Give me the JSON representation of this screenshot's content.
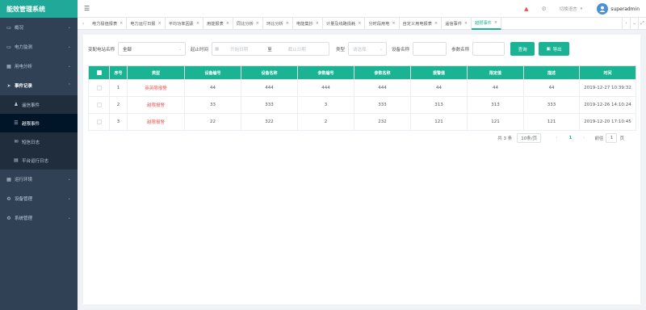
{
  "app": {
    "title": "能效管理系统"
  },
  "sidebar": {
    "items": [
      {
        "label": "概况",
        "icon": "monitor-icon"
      },
      {
        "label": "电力监测",
        "icon": "monitor-icon"
      },
      {
        "label": "用电分析",
        "icon": "chart-icon"
      },
      {
        "label": "事件记录",
        "icon": "cursor-icon"
      },
      {
        "label": "运行环境",
        "icon": "grid-icon"
      },
      {
        "label": "设备管理",
        "icon": "gear-icon"
      },
      {
        "label": "系统管理",
        "icon": "gear-icon"
      }
    ],
    "sub_items": [
      {
        "label": "遥信事件",
        "icon": "bell-icon"
      },
      {
        "label": "越限事件",
        "icon": "list-icon"
      },
      {
        "label": "短信日志",
        "icon": "mail-icon"
      },
      {
        "label": "平台运行日志",
        "icon": "doc-icon"
      }
    ]
  },
  "header": {
    "language": "切换语言",
    "username": "superadmin"
  },
  "tabs": [
    {
      "label": "电力极值报表"
    },
    {
      "label": "电力运行日报"
    },
    {
      "label": "平均功率因素"
    },
    {
      "label": "用能报表"
    },
    {
      "label": "同比分析"
    },
    {
      "label": "环比分析"
    },
    {
      "label": "电能集抄"
    },
    {
      "label": "计量及线路损耗"
    },
    {
      "label": "分时段用电"
    },
    {
      "label": "自定义用电报表"
    },
    {
      "label": "遥信事件"
    },
    {
      "label": "越限事件"
    }
  ],
  "filters": {
    "station_label": "变配电站名称",
    "station_value": "全部",
    "time_label": "起止时间",
    "start_placeholder": "开始日期",
    "to_label": "至",
    "end_placeholder": "截止日期",
    "type_label": "类型",
    "type_placeholder": "请选择",
    "device_label": "设备名称",
    "param_label": "参数名称",
    "query_button": "查询",
    "export_button": "导出"
  },
  "table": {
    "columns": [
      "序号",
      "类型",
      "设备编号",
      "设备名称",
      "参数编号",
      "参数名称",
      "报警值",
      "限定值",
      "描述",
      "时间"
    ],
    "rows": [
      [
        "1",
        "英英限报警",
        "44",
        "444",
        "444",
        "444",
        "44",
        "44",
        "44",
        "2019-12-27 10:39:32"
      ],
      [
        "2",
        "越限报警",
        "33",
        "333",
        "3",
        "333",
        "313",
        "313",
        "333",
        "2019-12-26 14:10:24"
      ],
      [
        "3",
        "越限报警",
        "22",
        "322",
        "2",
        "232",
        "121",
        "121",
        "121",
        "2019-12-20 17:10:45"
      ]
    ]
  },
  "pagination": {
    "total": "共 3 条",
    "page_size": "10条/页",
    "current_page": "1",
    "goto_label": "前往",
    "goto_value": "1",
    "page_unit": "页"
  },
  "colors": {
    "accent": "#1ab394",
    "sidebar": "#304156",
    "alarm_text": "#e05b5b"
  }
}
